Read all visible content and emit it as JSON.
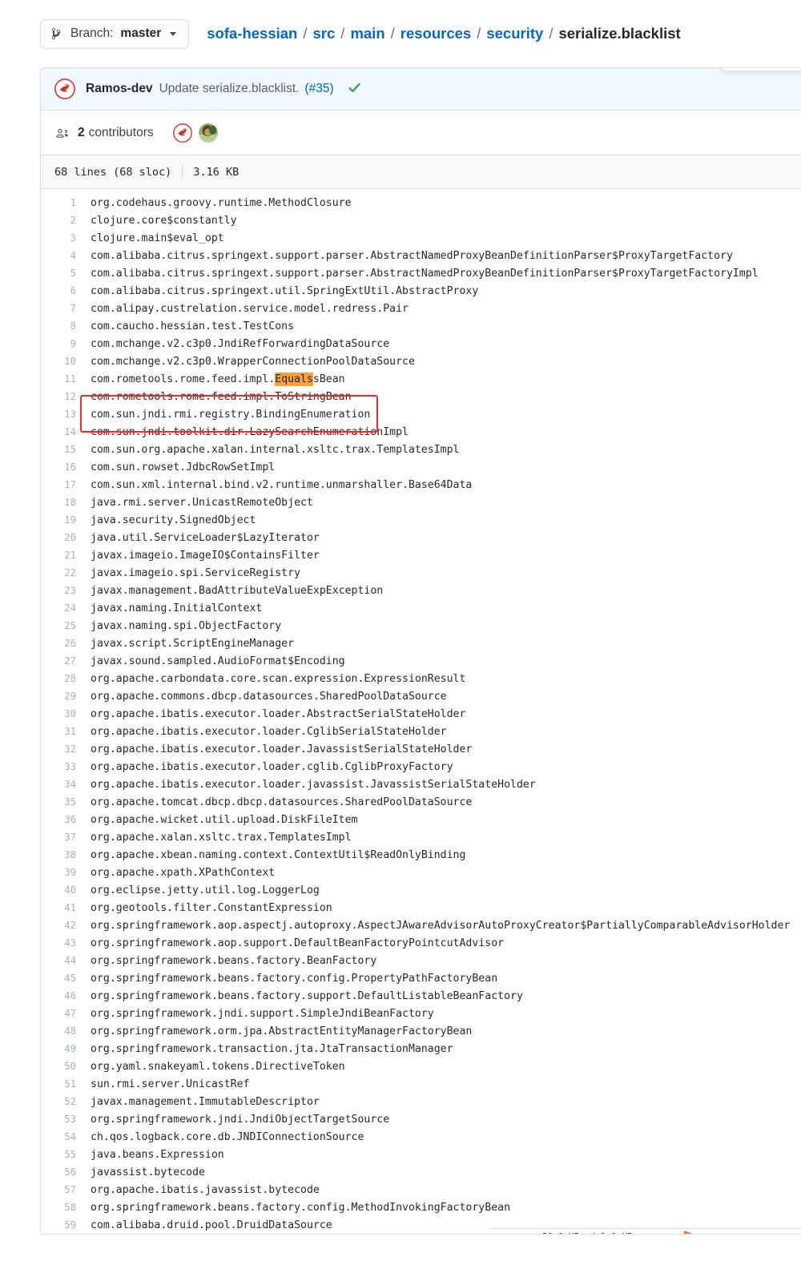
{
  "topbar": {
    "branch_button": {
      "icon": "git-branch-icon",
      "prefix": "Branch:",
      "name": "master",
      "caret": "chevron-down-icon"
    },
    "breadcrumb": {
      "parts": [
        "sofa-hessian",
        "src",
        "main",
        "resources",
        "security"
      ],
      "separator": "/",
      "final": "serialize.blacklist"
    }
  },
  "commit": {
    "author": "Ramos-dev",
    "message": "Update serialize.blacklist.",
    "pr": "(#35)",
    "status_icon": "check-icon",
    "avatar_icon": "author-avatar"
  },
  "contributors": {
    "icon": "people-icon",
    "count": "2",
    "label": "contributors"
  },
  "file_meta": {
    "lines": "68 lines (68 sloc)",
    "size": "3.16 KB"
  },
  "annotation": {
    "highlight_color": "#f9a03c",
    "box_color": "#ee2b26",
    "highlight_token": "Equals",
    "boxed_lines": [
      11,
      12
    ]
  },
  "code": {
    "lines": [
      {
        "n": 1,
        "t": "org.codehaus.groovy.runtime.MethodClosure"
      },
      {
        "n": 2,
        "t": "clojure.core$constantly"
      },
      {
        "n": 3,
        "t": "clojure.main$eval_opt"
      },
      {
        "n": 4,
        "t": "com.alibaba.citrus.springext.support.parser.AbstractNamedProxyBeanDefinitionParser$ProxyTargetFactory"
      },
      {
        "n": 5,
        "t": "com.alibaba.citrus.springext.support.parser.AbstractNamedProxyBeanDefinitionParser$ProxyTargetFactoryImpl"
      },
      {
        "n": 6,
        "t": "com.alibaba.citrus.springext.util.SpringExtUtil.AbstractProxy"
      },
      {
        "n": 7,
        "t": "com.alipay.custrelation.service.model.redress.Pair"
      },
      {
        "n": 8,
        "t": "com.caucho.hessian.test.TestCons"
      },
      {
        "n": 9,
        "t": "com.mchange.v2.c3p0.JndiRefForwardingDataSource"
      },
      {
        "n": 10,
        "t": "com.mchange.v2.c3p0.WrapperConnectionPoolDataSource"
      },
      {
        "n": 11,
        "t": "com.rometools.rome.feed.impl.EqualsBean",
        "pre": "com.rometools.rome.feed.impl.",
        "mark": "Equals",
        "post": "sBean"
      },
      {
        "n": 12,
        "t": "com.rometools.rome.feed.impl.ToStringBean"
      },
      {
        "n": 13,
        "t": "com.sun.jndi.rmi.registry.BindingEnumeration"
      },
      {
        "n": 14,
        "t": "com.sun.jndi.toolkit.dir.LazySearchEnumerationImpl"
      },
      {
        "n": 15,
        "t": "com.sun.org.apache.xalan.internal.xsltc.trax.TemplatesImpl"
      },
      {
        "n": 16,
        "t": "com.sun.rowset.JdbcRowSetImpl"
      },
      {
        "n": 17,
        "t": "com.sun.xml.internal.bind.v2.runtime.unmarshaller.Base64Data"
      },
      {
        "n": 18,
        "t": "java.rmi.server.UnicastRemoteObject"
      },
      {
        "n": 19,
        "t": "java.security.SignedObject"
      },
      {
        "n": 20,
        "t": "java.util.ServiceLoader$LazyIterator"
      },
      {
        "n": 21,
        "t": "javax.imageio.ImageIO$ContainsFilter"
      },
      {
        "n": 22,
        "t": "javax.imageio.spi.ServiceRegistry"
      },
      {
        "n": 23,
        "t": "javax.management.BadAttributeValueExpException"
      },
      {
        "n": 24,
        "t": "javax.naming.InitialContext"
      },
      {
        "n": 25,
        "t": "javax.naming.spi.ObjectFactory"
      },
      {
        "n": 26,
        "t": "javax.script.ScriptEngineManager"
      },
      {
        "n": 27,
        "t": "javax.sound.sampled.AudioFormat$Encoding"
      },
      {
        "n": 28,
        "t": "org.apache.carbondata.core.scan.expression.ExpressionResult"
      },
      {
        "n": 29,
        "t": "org.apache.commons.dbcp.datasources.SharedPoolDataSource"
      },
      {
        "n": 30,
        "t": "org.apache.ibatis.executor.loader.AbstractSerialStateHolder"
      },
      {
        "n": 31,
        "t": "org.apache.ibatis.executor.loader.CglibSerialStateHolder"
      },
      {
        "n": 32,
        "t": "org.apache.ibatis.executor.loader.JavassistSerialStateHolder"
      },
      {
        "n": 33,
        "t": "org.apache.ibatis.executor.loader.cglib.CglibProxyFactory"
      },
      {
        "n": 34,
        "t": "org.apache.ibatis.executor.loader.javassist.JavassistSerialStateHolder"
      },
      {
        "n": 35,
        "t": "org.apache.tomcat.dbcp.dbcp.datasources.SharedPoolDataSource"
      },
      {
        "n": 36,
        "t": "org.apache.wicket.util.upload.DiskFileItem"
      },
      {
        "n": 37,
        "t": "org.apache.xalan.xsltc.trax.TemplatesImpl"
      },
      {
        "n": 38,
        "t": "org.apache.xbean.naming.context.ContextUtil$ReadOnlyBinding"
      },
      {
        "n": 39,
        "t": "org.apache.xpath.XPathContext"
      },
      {
        "n": 40,
        "t": "org.eclipse.jetty.util.log.LoggerLog"
      },
      {
        "n": 41,
        "t": "org.geotools.filter.ConstantExpression"
      },
      {
        "n": 42,
        "t": "org.springframework.aop.aspectj.autoproxy.AspectJAwareAdvisorAutoProxyCreator$PartiallyComparableAdvisorHolder"
      },
      {
        "n": 43,
        "t": "org.springframework.aop.support.DefaultBeanFactoryPointcutAdvisor"
      },
      {
        "n": 44,
        "t": "org.springframework.beans.factory.BeanFactory"
      },
      {
        "n": 45,
        "t": "org.springframework.beans.factory.config.PropertyPathFactoryBean"
      },
      {
        "n": 46,
        "t": "org.springframework.beans.factory.support.DefaultListableBeanFactory"
      },
      {
        "n": 47,
        "t": "org.springframework.jndi.support.SimpleJndiBeanFactory"
      },
      {
        "n": 48,
        "t": "org.springframework.orm.jpa.AbstractEntityManagerFactoryBean"
      },
      {
        "n": 49,
        "t": "org.springframework.transaction.jta.JtaTransactionManager"
      },
      {
        "n": 50,
        "t": "org.yaml.snakeyaml.tokens.DirectiveToken"
      },
      {
        "n": 51,
        "t": "sun.rmi.server.UnicastRef"
      },
      {
        "n": 52,
        "t": "javax.management.ImmutableDescriptor"
      },
      {
        "n": 53,
        "t": "org.springframework.jndi.JndiObjectTargetSource"
      },
      {
        "n": 54,
        "t": "ch.qos.logback.core.db.JNDIConnectionSource"
      },
      {
        "n": 55,
        "t": "java.beans.Expression"
      },
      {
        "n": 56,
        "t": "javassist.bytecode"
      },
      {
        "n": 57,
        "t": "org.apache.ibatis.javassist.bytecode"
      },
      {
        "n": 58,
        "t": "org.springframework.beans.factory.config.MethodInvokingFactoryBean"
      },
      {
        "n": 59,
        "t": "com.alibaba.druid.pool.DruidDataSource"
      }
    ]
  }
}
